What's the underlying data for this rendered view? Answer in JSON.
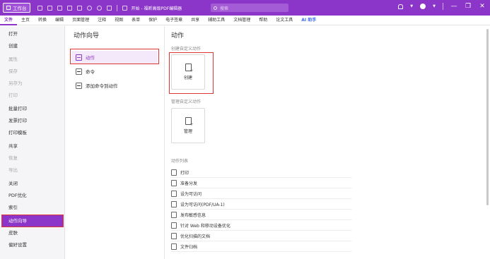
{
  "titlebar": {
    "workspace_label": "工作台",
    "doc_title": "开始 - 福昕高级PDF编辑器",
    "search_placeholder": "搜索",
    "bg_color": "#8c35c9"
  },
  "menubar": {
    "items": [
      "文件",
      "主页",
      "转换",
      "编辑",
      "页面管理",
      "注释",
      "视图",
      "表单",
      "保护",
      "电子签章",
      "共享",
      "辅助工具",
      "文档管理",
      "帮助",
      "论文工具",
      "AI 助手"
    ],
    "active_index": 0
  },
  "leftnav": {
    "items": [
      {
        "label": "打开",
        "disabled": false
      },
      {
        "label": "创建",
        "disabled": false
      },
      {
        "label": "属性",
        "disabled": true
      },
      {
        "label": "保存",
        "disabled": true
      },
      {
        "label": "另存为",
        "disabled": true
      },
      {
        "label": "打印",
        "disabled": true
      },
      {
        "label": "批量打印",
        "disabled": false
      },
      {
        "label": "发票打印",
        "disabled": false
      },
      {
        "label": "打印模板",
        "disabled": false
      },
      {
        "label": "共享",
        "disabled": false
      },
      {
        "label": "恢复",
        "disabled": true
      },
      {
        "label": "导出",
        "disabled": true
      },
      {
        "label": "关闭",
        "disabled": false
      },
      {
        "label": "PDF优化",
        "disabled": false
      },
      {
        "label": "索引",
        "disabled": false
      },
      {
        "label": "动作向导",
        "disabled": false
      },
      {
        "label": "皮肤",
        "disabled": false
      },
      {
        "label": "偏好设置",
        "disabled": false
      }
    ],
    "selected_label": "动作向导"
  },
  "middle": {
    "title": "动作向导",
    "items": [
      "动作",
      "命令",
      "添加命令到动作"
    ]
  },
  "content": {
    "title": "动作",
    "create_section_label": "创建自定义动作",
    "create_card_label": "创建",
    "manage_section_label": "管理自定义动作",
    "manage_card_label": "管理",
    "list_section_label": "动作列表",
    "actions": [
      "打印",
      "准备分发",
      "设为可访问",
      "设为可访问(PDF/UA-1)",
      "发布敏感信息",
      "针对 Web 和移动设备优化",
      "优化扫描的文档",
      "文件归档"
    ]
  },
  "colors": {
    "accent": "#8c35c9",
    "highlight_frame": "#e03535",
    "ai_link": "#3b6cf0"
  }
}
